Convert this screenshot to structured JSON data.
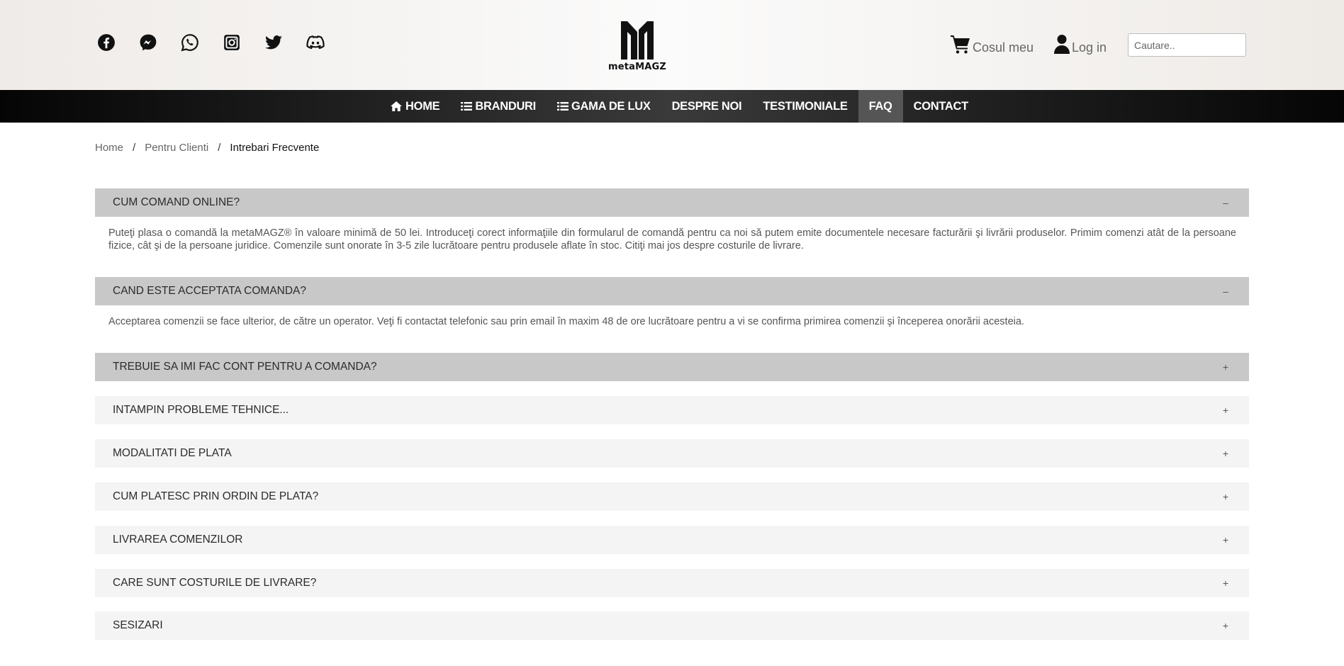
{
  "header": {
    "socials": [
      {
        "icon": "facebook-icon"
      },
      {
        "icon": "messenger-icon"
      },
      {
        "icon": "whatsapp-icon"
      },
      {
        "icon": "instagram-icon"
      },
      {
        "icon": "twitter-icon"
      },
      {
        "icon": "discord-icon"
      }
    ],
    "logo_text": "metaMAGZ",
    "cart_label": "Cosul meu",
    "login_label": "Log in",
    "search_placeholder": "Cautare.."
  },
  "nav": {
    "items": [
      {
        "label": "HOME",
        "icon": "home-icon"
      },
      {
        "label": "BRANDURI",
        "icon": "list-icon"
      },
      {
        "label": "GAMA DE LUX",
        "icon": "list-icon"
      },
      {
        "label": "DESPRE NOI"
      },
      {
        "label": "TESTIMONIALE"
      },
      {
        "label": "FAQ",
        "active": true
      },
      {
        "label": "CONTACT"
      }
    ]
  },
  "breadcrumb": {
    "home": "Home",
    "sep1": "/",
    "section": "Pentru Clienti",
    "sep2": "/",
    "current": "Intrebari Frecvente"
  },
  "faq": {
    "items": [
      {
        "question": "CUM COMAND ONLINE?",
        "sign": "–",
        "answer": "Puteţi plasa o comandă la metaMAGZ® în valoare minimă de 50 lei. Introduceţi corect informaţiile din formularul de comandă pentru ca noi să putem emite documentele necesare facturării şi livrării produselor. Primim comenzi atât de la persoane fizice, cât şi de la persoane juridice. Comenzile sunt onorate în 3-5 zile lucrătoare pentru produsele aflate în stoc. Citiţi mai jos despre costurile de livrare."
      },
      {
        "question": "CAND ESTE ACCEPTATA COMANDA?",
        "sign": "–",
        "answer": "Acceptarea comenzii se face ulterior, de către un operator. Veţi fi contactat telefonic sau prin email în maxim 48 de ore lucrătoare pentru a vi se confirma primirea comenzii şi începerea onorării acesteia."
      },
      {
        "question": "TREBUIE SA IMI FAC CONT PENTRU A COMANDA?",
        "sign": "+"
      },
      {
        "question": "INTAMPIN PROBLEME TEHNICE...",
        "sign": "+"
      },
      {
        "question": "MODALITATI DE PLATA",
        "sign": "+"
      },
      {
        "question": "CUM PLATESC PRIN ORDIN DE PLATA?",
        "sign": "+"
      },
      {
        "question": "LIVRAREA COMENZILOR",
        "sign": "+"
      },
      {
        "question": "CARE SUNT COSTURILE DE LIVRARE?",
        "sign": "+"
      },
      {
        "question": "SESIZARI",
        "sign": "+"
      }
    ]
  },
  "colors": {
    "nav_active": "#555555",
    "faq_open_header": "#c8c8c8",
    "faq_closed_header": "#f4f4f4"
  }
}
